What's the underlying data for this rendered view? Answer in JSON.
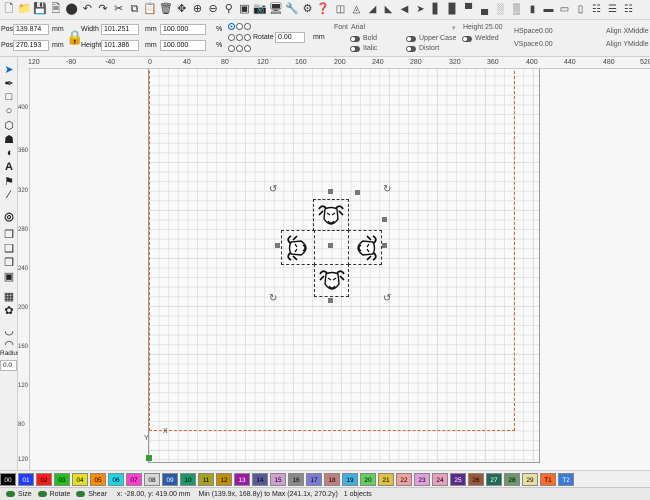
{
  "toolbar": {
    "icons": [
      "new-file-icon",
      "open-folder-icon",
      "save-icon",
      "save-as-icon",
      "cut-out-icon",
      "undo-icon",
      "redo-icon",
      "scissors-icon",
      "copy-icon",
      "paste-icon",
      "delete-icon",
      "move-icon",
      "zoom-in-icon",
      "zoom-out-icon",
      "zoom-fit-icon",
      "frame-icon",
      "camera-icon",
      "monitor-icon",
      "tools-icon",
      "settings-icon",
      "help-icon"
    ]
  },
  "props": {
    "xpos_label": "Pos",
    "xpos_value": "139.874",
    "ypos_label": "Pos",
    "ypos_value": "270.193",
    "unit": "mm",
    "width_label": "Width",
    "width_value": "101.251",
    "height_label": "Height",
    "height_value": "101.386",
    "wpct_value": "100.000",
    "hpct_value": "100.000",
    "pct": "%",
    "rotate_label": "Rotate",
    "rotate_value": "0.00",
    "rotate_unit": "mm"
  },
  "textpanel": {
    "font_label": "Font",
    "font_value": "Arial",
    "height_label": "Height",
    "height_value": "25.00",
    "hspace_label": "HSpace",
    "hspace_value": "0.00",
    "vspace_label": "VSpace",
    "vspace_value": "0.00",
    "alignx_label": "Align X",
    "alignx_value": "Middle",
    "aligny_label": "Align Y",
    "aligny_value": "Middle",
    "bold": "Bold",
    "italic": "Italic",
    "upper": "Upper Case",
    "distort": "Distort",
    "welded": "Welded"
  },
  "lefttools": {
    "radius_label": "Radius:",
    "radius_value": "0.0"
  },
  "ruler": {
    "top": [
      "120",
      "-80",
      "-40",
      "0",
      "40",
      "80",
      "120",
      "160",
      "200",
      "240",
      "280",
      "320",
      "360",
      "400",
      "440",
      "480",
      "520"
    ],
    "left": [
      "400",
      "360",
      "320",
      "280",
      "240",
      "200",
      "160",
      "120",
      "80",
      "40",
      "120"
    ],
    "x_axis": "X",
    "y_axis": "Y"
  },
  "palette": [
    {
      "label": "00",
      "color": "#000000"
    },
    {
      "label": "01",
      "color": "#1f3dff"
    },
    {
      "label": "02",
      "color": "#ff1a1a"
    },
    {
      "label": "03",
      "color": "#20c020"
    },
    {
      "label": "04",
      "color": "#e6e020"
    },
    {
      "label": "05",
      "color": "#ff8a00"
    },
    {
      "label": "06",
      "color": "#1ad6e6"
    },
    {
      "label": "07",
      "color": "#ff40d0"
    },
    {
      "label": "08",
      "color": "#d8d8d8"
    },
    {
      "label": "09",
      "color": "#2a5aa8"
    },
    {
      "label": "10",
      "color": "#1a9a6a"
    },
    {
      "label": "11",
      "color": "#a8a020"
    },
    {
      "label": "12",
      "color": "#c09000"
    },
    {
      "label": "13",
      "color": "#9a1aa8"
    },
    {
      "label": "14",
      "color": "#5a5a9a"
    },
    {
      "label": "15",
      "color": "#d0a0d0"
    },
    {
      "label": "16",
      "color": "#8a8a8a"
    },
    {
      "label": "17",
      "color": "#7a7ad8"
    },
    {
      "label": "18",
      "color": "#c08080"
    },
    {
      "label": "19",
      "color": "#40b0e0"
    },
    {
      "label": "20",
      "color": "#60d060"
    },
    {
      "label": "21",
      "color": "#e0c040"
    },
    {
      "label": "22",
      "color": "#f0a0a0"
    },
    {
      "label": "23",
      "color": "#e0a0e0"
    },
    {
      "label": "24",
      "color": "#e8a0c0"
    },
    {
      "label": "25",
      "color": "#5a2a8a"
    },
    {
      "label": "26",
      "color": "#9a5a3a"
    },
    {
      "label": "27",
      "color": "#206a5a"
    },
    {
      "label": "28",
      "color": "#6a9a6a"
    },
    {
      "label": "29",
      "color": "#e8e0a0"
    },
    {
      "label": "T1",
      "color": "#ff6a2a"
    },
    {
      "label": "T2",
      "color": "#3a7ad8"
    }
  ],
  "status": {
    "size": "Size",
    "rotate": "Rotate",
    "shear": "Shear",
    "coords": "x: -28.00, y: 419.00 mm",
    "bounds": "Min (139.9x, 168.8y) to Max (241.1x, 270.2y)",
    "objects": "1 objects"
  }
}
